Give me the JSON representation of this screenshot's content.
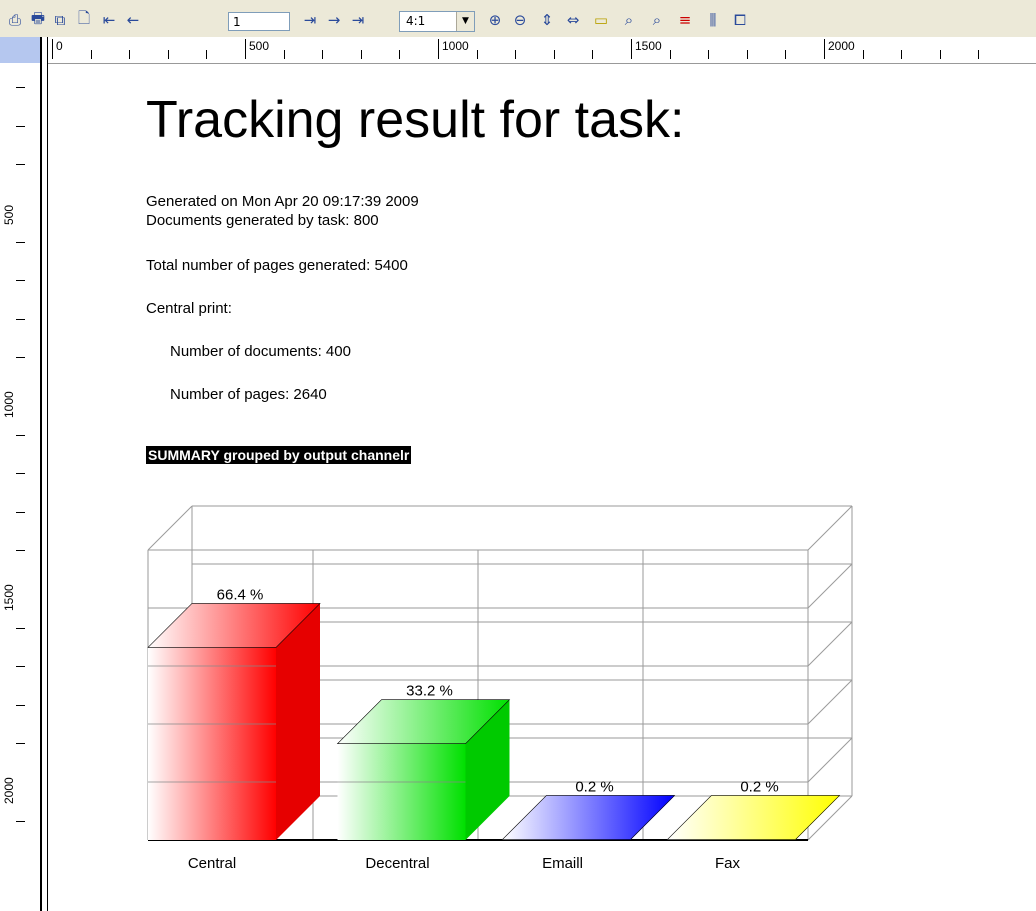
{
  "toolbar": {
    "page_value": "1",
    "zoom_value": "4:1",
    "icons": [
      "printer-icon",
      "print-setup-icon",
      "copy-icon",
      "open-document-icon",
      "first-page-icon",
      "previous-page-icon",
      "next-page-icon",
      "forward-icon",
      "last-page-icon",
      "zoom-in-icon",
      "zoom-out-icon",
      "fit-height-icon",
      "fit-width-icon",
      "note-icon",
      "find-icon",
      "find-next-icon",
      "lines-icon",
      "columns-icon",
      "pages-icon"
    ]
  },
  "ruler": {
    "h_labels": [
      "0",
      "500",
      "1000",
      "1500",
      "2000"
    ],
    "v_labels": [
      "500",
      "1000",
      "1500",
      "2000"
    ]
  },
  "report": {
    "title": "Tracking result for task:",
    "generated_on": "Generated on Mon Apr 20 09:17:39 2009",
    "documents_generated": "Documents generated by task: 800",
    "total_pages": "Total number of pages generated: 5400",
    "central_print": "Central print:",
    "num_documents": "Number of documents: 400",
    "num_pages": "Number of pages: 2640",
    "summary_heading": "SUMMARY grouped by output channelr"
  },
  "chart_data": {
    "type": "bar",
    "title": "",
    "categories": [
      "Central",
      "Decentral",
      "Emaill",
      "Fax"
    ],
    "values": [
      66.4,
      33.2,
      0.2,
      0.2
    ],
    "labels": [
      "66.4 %",
      "33.2 %",
      "0.2 %",
      "0.2 %"
    ],
    "colors": [
      "#ff0000",
      "#00e000",
      "#0000ff",
      "#ffff00"
    ],
    "ylim": [
      0,
      100
    ],
    "grid": true,
    "three_d": true,
    "xlabel": "",
    "ylabel": ""
  }
}
